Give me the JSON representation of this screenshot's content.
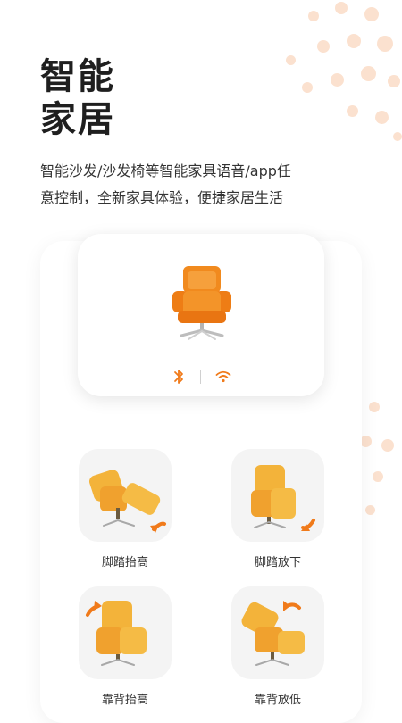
{
  "headline": {
    "line1": "智能",
    "line2": "家居"
  },
  "description": {
    "line1": "智能沙发/沙发椅等智能家具语音/app任",
    "line2": "意控制，全新家具体验，便捷家居生活"
  },
  "device_card": {
    "image": "orange-recliner-chair",
    "connection_icons": [
      "bluetooth-icon",
      "wifi-icon"
    ]
  },
  "controls": [
    {
      "label": "脚踏抬高",
      "icon": "footrest-raise-icon"
    },
    {
      "label": "脚踏放下",
      "icon": "footrest-lower-icon"
    },
    {
      "label": "靠背抬高",
      "icon": "backrest-raise-icon"
    },
    {
      "label": "靠背放低",
      "icon": "backrest-lower-icon"
    }
  ],
  "colors": {
    "accent": "#f07a1a",
    "chair_yellow": "#f3b33a",
    "chair_orange": "#f18a1e",
    "tile_bg": "#f4f4f4",
    "dots": "#f7c8a8"
  }
}
